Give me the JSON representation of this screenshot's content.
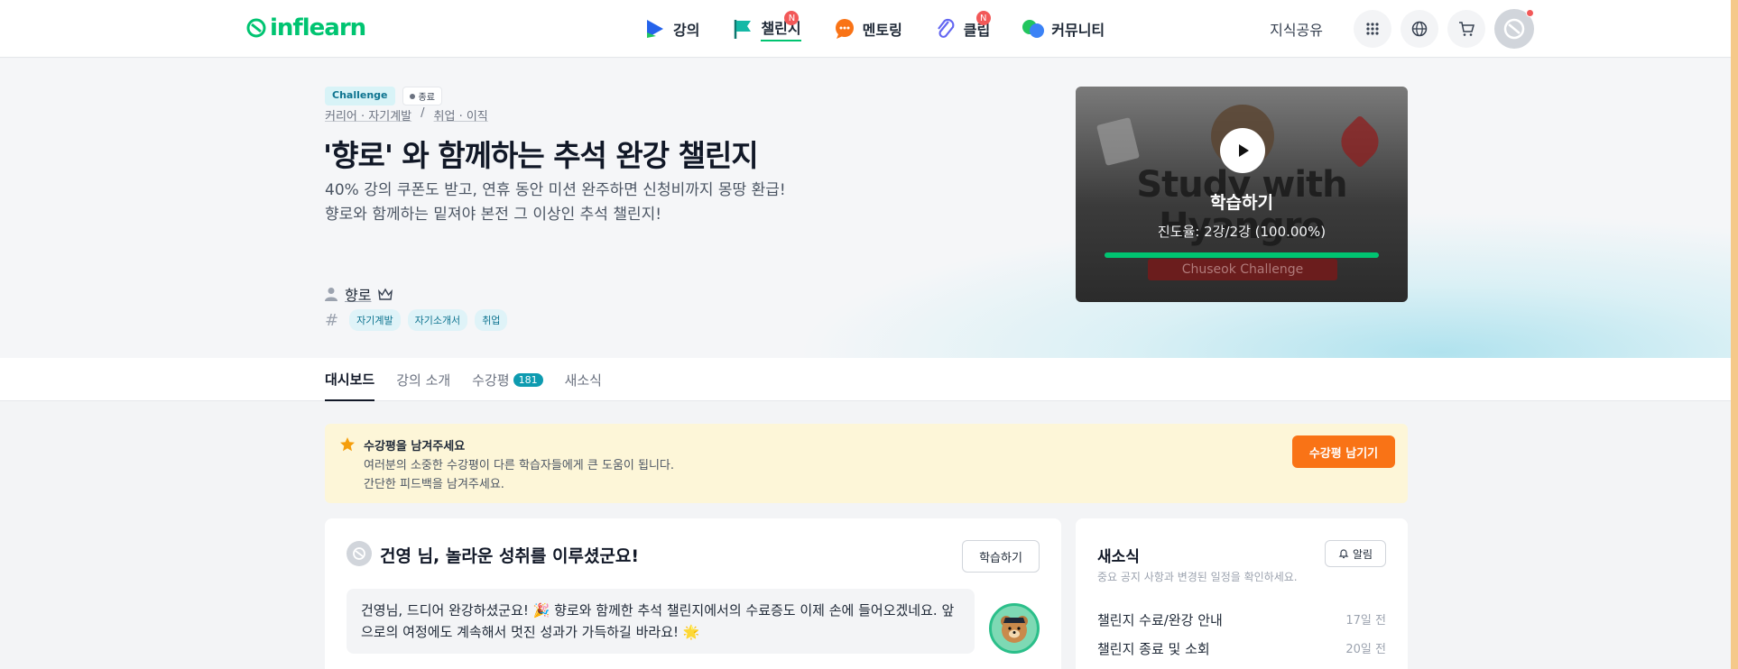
{
  "brand": {
    "logo_text": "inflearn",
    "accent": "#00c471"
  },
  "nav": {
    "items": [
      {
        "label": "강의",
        "icon": "play-icon",
        "badge": ""
      },
      {
        "label": "챌린지",
        "icon": "flag-icon",
        "badge": "N"
      },
      {
        "label": "멘토링",
        "icon": "chat-bubble-icon",
        "badge": ""
      },
      {
        "label": "클립",
        "icon": "clip-icon",
        "badge": "N"
      },
      {
        "label": "커뮤니티",
        "icon": "community-icon",
        "badge": ""
      }
    ],
    "right_link": "지식공유"
  },
  "hero": {
    "tag_challenge": "Challenge",
    "tag_status": "종료",
    "breadcrumb": [
      "커리어 · 자기계발",
      "/",
      "취업 · 이직"
    ],
    "title": "'향로' 와 함께하는 추석 완강 챌린지",
    "desc_line1": "40% 강의 쿠폰도 받고, 연휴 동안 미션 완주하면 신청비까지 몽땅 환급!",
    "desc_line2": "향로와 함께하는 밑져야 본전 그 이상인 추석 챌린지!",
    "instructor": "향로",
    "tags": [
      "자기계발",
      "자기소개서",
      "취업"
    ]
  },
  "video": {
    "thumb_text": "Study with Hyangro",
    "thumb_banner": "Chuseok Challenge",
    "action_label": "학습하기",
    "progress_text": "진도율: 2강/2강 (100.00%)",
    "progress_fraction": 1.0
  },
  "tabs": [
    {
      "label": "대시보드",
      "count": ""
    },
    {
      "label": "강의 소개",
      "count": ""
    },
    {
      "label": "수강평",
      "count": "181"
    },
    {
      "label": "새소식",
      "count": ""
    }
  ],
  "review_banner": {
    "title": "수강평을 남겨주세요",
    "line1": "여러분의 소중한 수강평이 다른 학습자들에게 큰 도움이 됩니다.",
    "line2": "간단한 피드백을 남겨주세요.",
    "button": "수강평 남기기"
  },
  "congrats": {
    "title": "건영 님, 놀라운 성취를 이루셨군요!",
    "button": "학습하기",
    "message": "건영님, 드디어 완강하셨군요! 🎉 향로와 함께한 추석 챌린지에서의 수료증도 이제 손에 들어오겠네요. 앞으로의 여정에도 계속해서 멋진 성과가 가득하길 바라요! 🌟"
  },
  "news": {
    "title": "새소식",
    "subtitle": "중요 공지 사항과 변경된 일정을 확인하세요.",
    "alert_button": "알림",
    "items": [
      {
        "title": "챌린지 수료/완강 안내",
        "when": "17일 전"
      },
      {
        "title": "챌린지 종료 및 소회",
        "when": "20일 전"
      }
    ]
  }
}
